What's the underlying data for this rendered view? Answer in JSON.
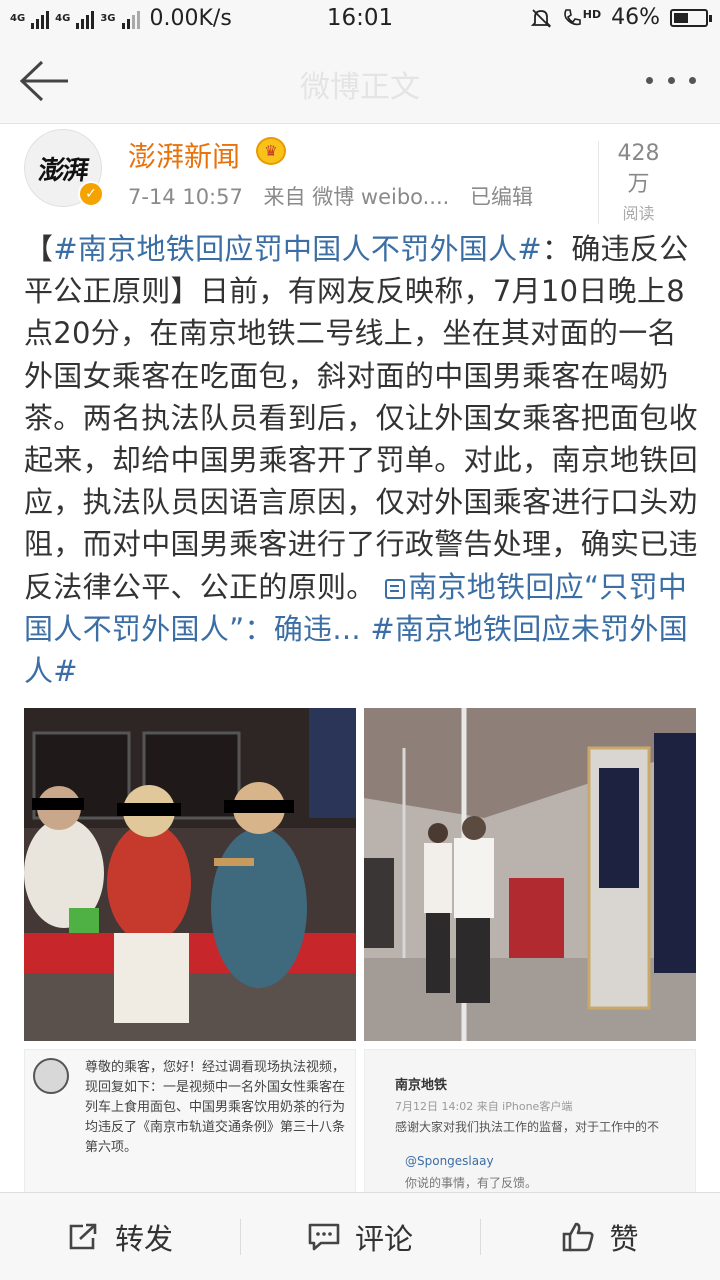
{
  "status_bar": {
    "network_a": "4G",
    "network_b": "4G",
    "network_c": "3G",
    "speed": "0.00K/s",
    "time": "16:01",
    "hd_label": "HD",
    "battery_text": "46%",
    "battery_level": 0.46
  },
  "nav": {
    "title": "微博正文"
  },
  "post": {
    "author": "澎湃新闻",
    "avatar_text": "澎湃",
    "time": "7-14 10:57",
    "source": "来自 微博 weibo....",
    "edited": "已编辑",
    "reads_count": "428万",
    "reads_label": "阅读",
    "body": {
      "bracket_open": "【",
      "hashtag_main": "#南京地铁回应罚中国人不罚外国人#",
      "headline_rest": "：确违反公平公正原则】",
      "text": "日前，有网友反映称，7月10日晚上8点20分，在南京地铁二号线上，坐在其对面的一名外国女乘客在吃面包，斜对面的中国男乘客在喝奶茶。两名执法队员看到后，仅让外国女乘客把面包收起来，却给中国男乘客开了罚单。对此，南京地铁回应，执法队员因语言原因，仅对外国乘客进行口头劝阻，而对中国男乘客进行了行政警告处理，确实已违反法律公平、公正的原则。",
      "article_link": "南京地铁回应“只罚中国人不罚外国人”：确违...",
      "hashtag_end": "#南京地铁回应未罚外国人#"
    },
    "images": {
      "img3_text": "尊敬的乘客，您好！经过调看现场执法视频，现回复如下：一是视频中一名外国女性乘客在列车上食用面包、中国男乘客饮用奶茶的行为均违反了《南京市轨道交通条例》第三十八条第六项。",
      "img4_name": "南京地铁",
      "img4_meta": "7月12日 14:02 来自 iPhone客户端",
      "img4_text": "感谢大家对我们执法工作的监督，对于工作中的不",
      "img4_user": "@Spongeslaay",
      "img4_reply": "你说的事情，有了反馈。"
    }
  },
  "actions": {
    "repost": "转发",
    "comment": "评论",
    "like": "赞"
  },
  "colors": {
    "link": "#3b6ea5",
    "author": "#e8720c",
    "nav_bg": "#f7f7f7"
  }
}
